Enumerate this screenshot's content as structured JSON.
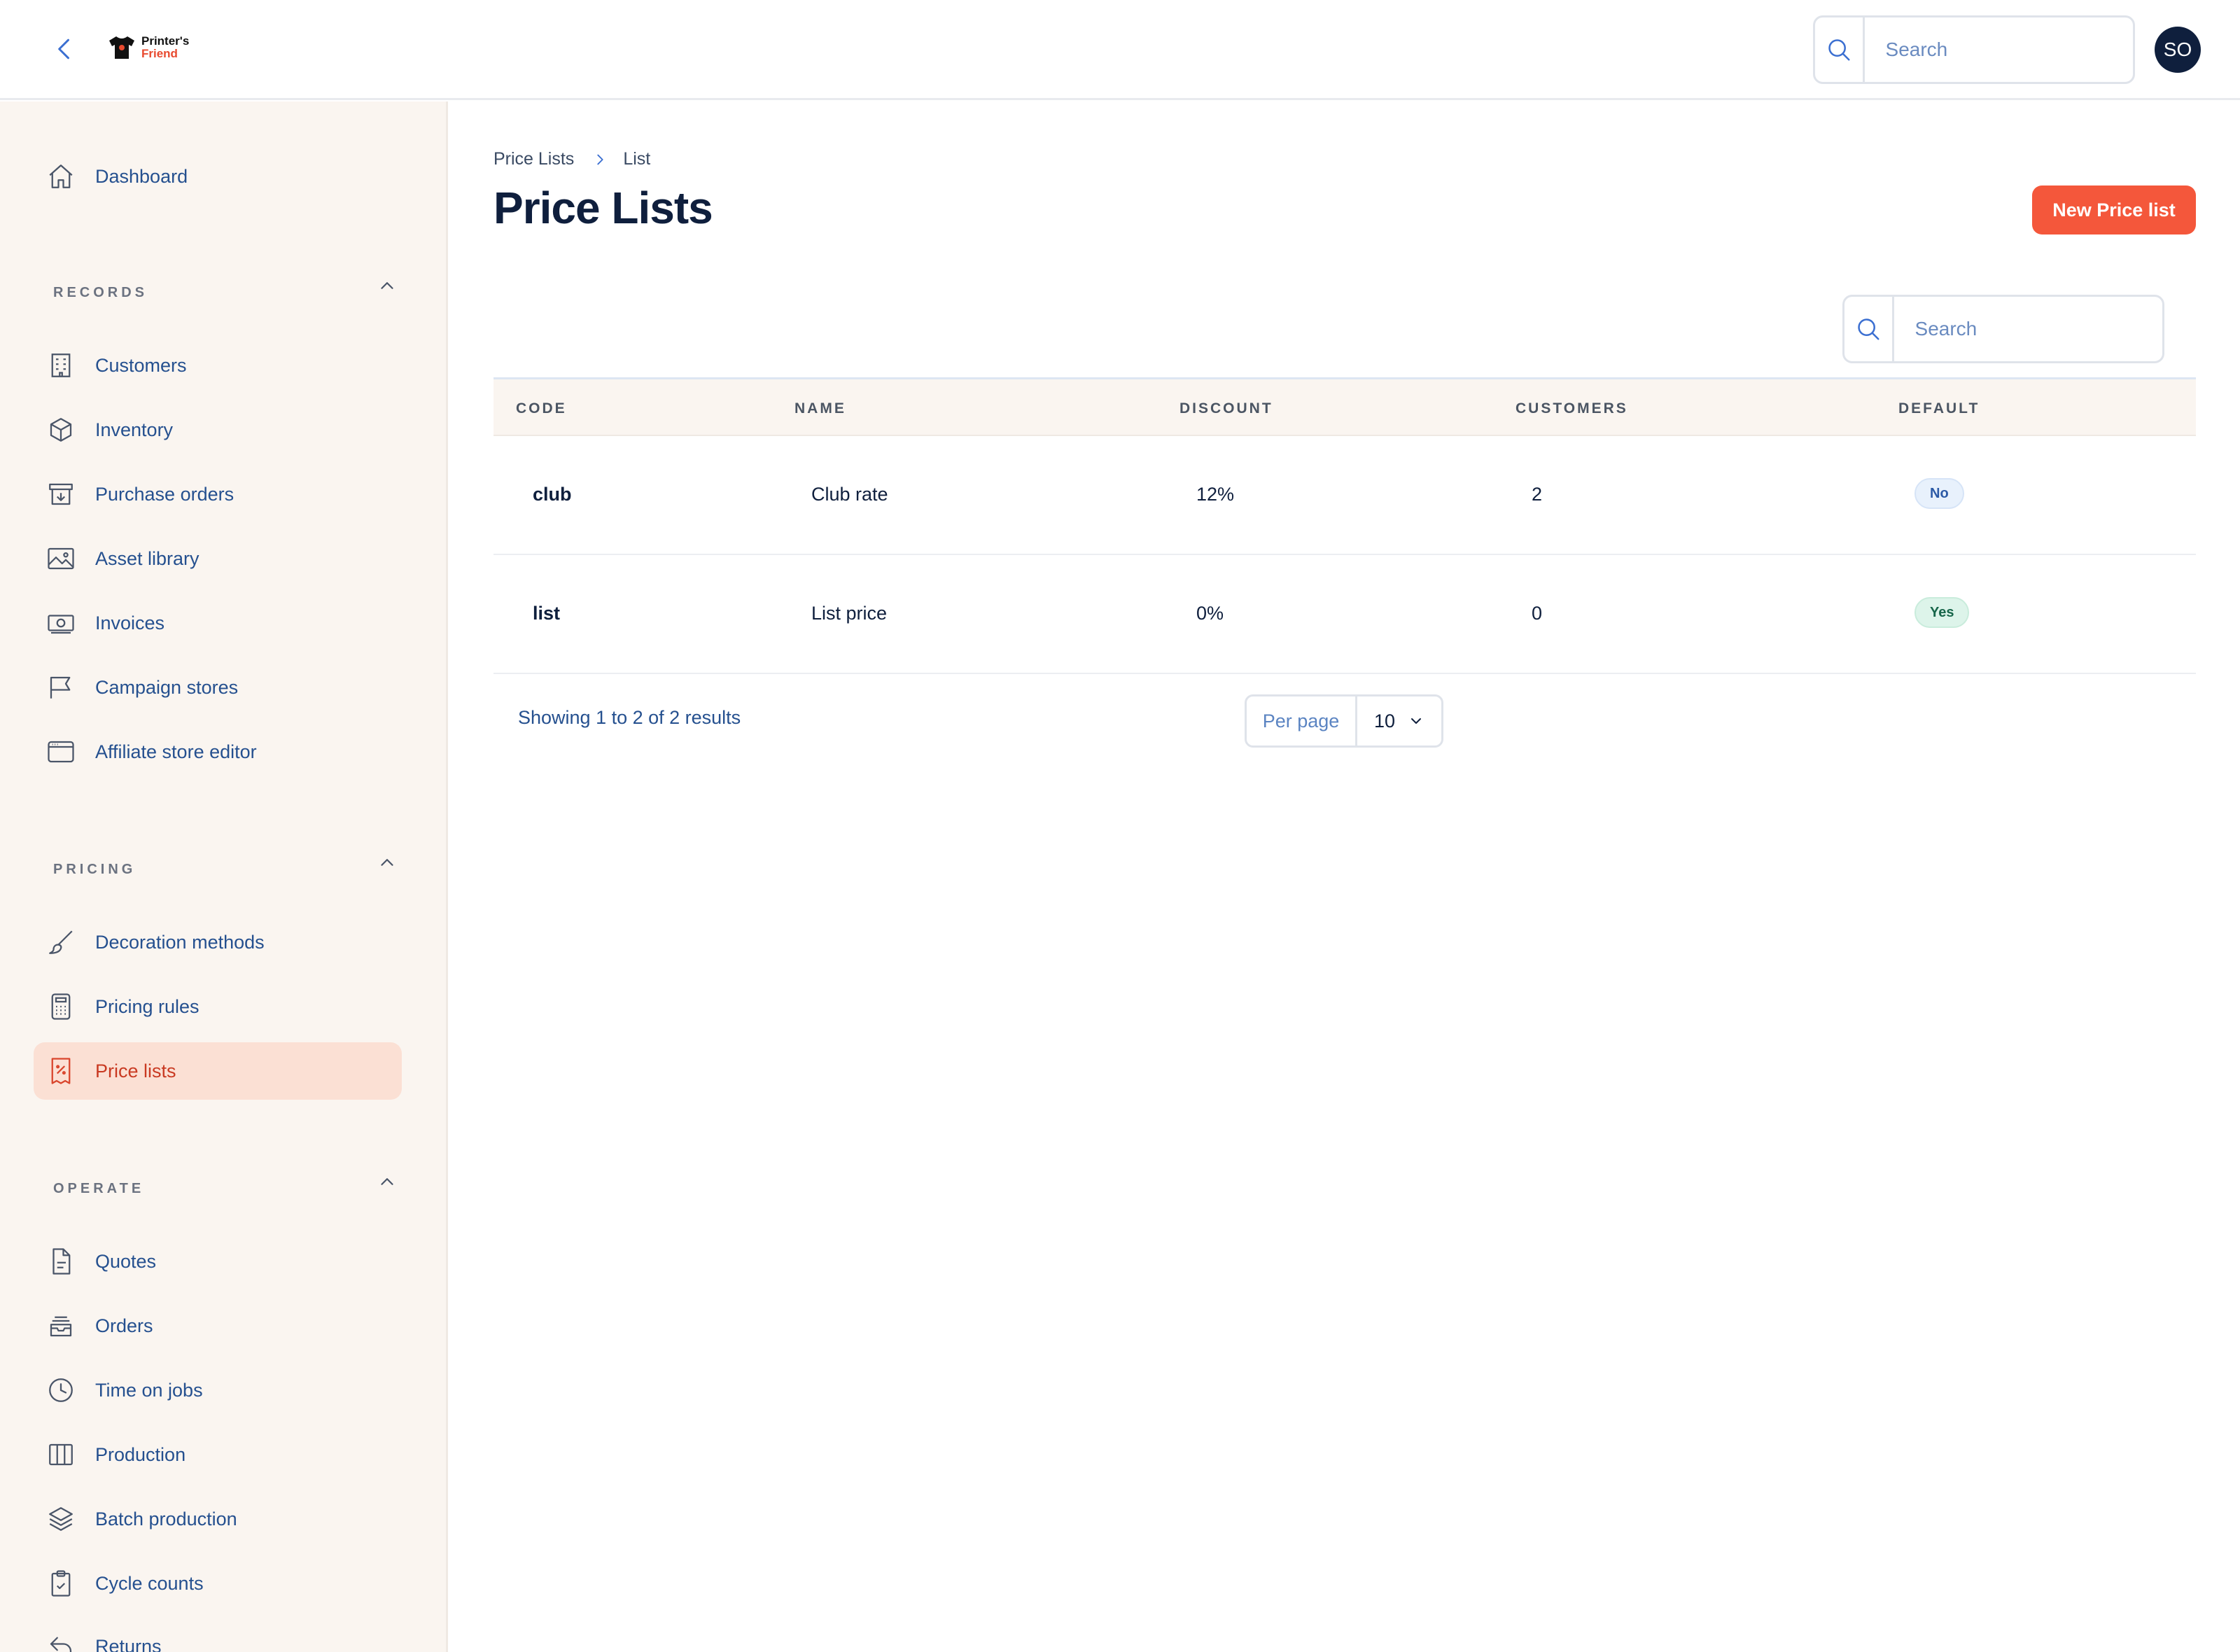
{
  "header": {
    "logo": {
      "line1": "Printer's",
      "line2": "Friend"
    },
    "search_placeholder": "Search",
    "avatar_initials": "SO"
  },
  "sidebar": {
    "dashboard": "Dashboard",
    "sections": [
      {
        "title": "RECORDS",
        "items": [
          {
            "label": "Customers",
            "icon": "building-icon"
          },
          {
            "label": "Inventory",
            "icon": "cube-icon"
          },
          {
            "label": "Purchase orders",
            "icon": "archive-download-icon"
          },
          {
            "label": "Asset library",
            "icon": "image-icon"
          },
          {
            "label": "Invoices",
            "icon": "banknote-icon"
          },
          {
            "label": "Campaign stores",
            "icon": "flag-icon"
          },
          {
            "label": "Affiliate store editor",
            "icon": "browser-window-icon"
          }
        ]
      },
      {
        "title": "PRICING",
        "items": [
          {
            "label": "Decoration methods",
            "icon": "paintbrush-icon"
          },
          {
            "label": "Pricing rules",
            "icon": "calculator-icon"
          },
          {
            "label": "Price lists",
            "icon": "receipt-percent-icon",
            "active": true
          }
        ]
      },
      {
        "title": "OPERATE",
        "items": [
          {
            "label": "Quotes",
            "icon": "document-icon"
          },
          {
            "label": "Orders",
            "icon": "inbox-stack-icon"
          },
          {
            "label": "Time on jobs",
            "icon": "clock-icon"
          },
          {
            "label": "Production",
            "icon": "columns-icon"
          },
          {
            "label": "Batch production",
            "icon": "layers-icon"
          },
          {
            "label": "Cycle counts",
            "icon": "clipboard-check-icon"
          },
          {
            "label": "Returns",
            "icon": "return-arrow-icon"
          }
        ]
      }
    ]
  },
  "main": {
    "breadcrumb": [
      "Price Lists",
      "List"
    ],
    "title": "Price Lists",
    "new_button": "New Price list",
    "table_search_placeholder": "Search",
    "columns": [
      "CODE",
      "NAME",
      "DISCOUNT",
      "CUSTOMERS",
      "DEFAULT"
    ],
    "rows": [
      {
        "code": "club",
        "name": "Club rate",
        "discount": "12%",
        "customers": "2",
        "default": "No"
      },
      {
        "code": "list",
        "name": "List price",
        "discount": "0%",
        "customers": "0",
        "default": "Yes"
      }
    ],
    "results_text": "Showing 1 to 2 of 2 results",
    "per_page_label": "Per page",
    "per_page_value": "10"
  },
  "colors": {
    "accent": "#f4573b",
    "sidebar_bg": "#faf5f0",
    "active_bg": "#fbe0d4",
    "nav_text": "#25508f",
    "heading": "#0f1f3d"
  }
}
